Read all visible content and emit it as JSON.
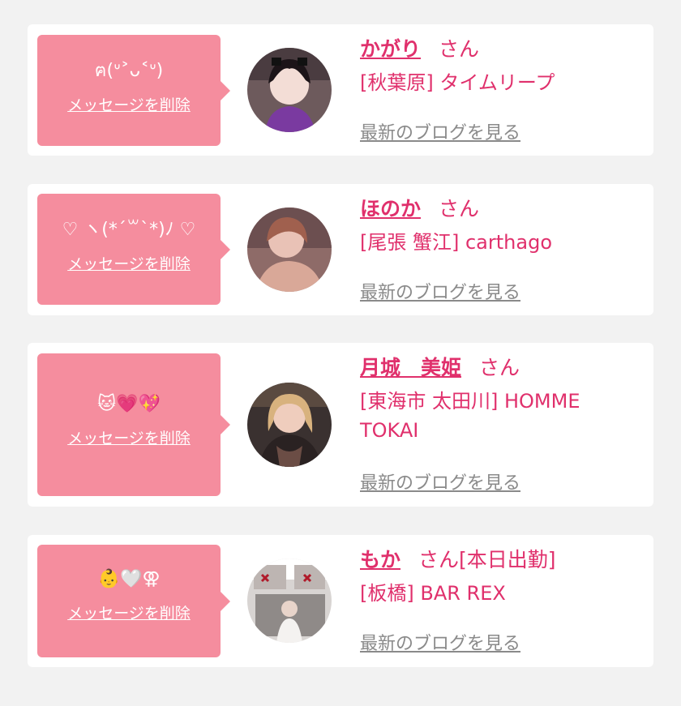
{
  "common": {
    "delete_label": "メッセージを削除",
    "san_label": "さん",
    "blog_label": "最新のブログを見る"
  },
  "colors": {
    "accent": "#e0306c",
    "bubble": "#f58d9e",
    "link_gray": "#8a8a8a",
    "background": "#f2f2f2"
  },
  "items": [
    {
      "message": "ฅ(ᐡ˃ᴗ˂ᐡ)",
      "name": "かがり",
      "shop": "[秋葉原] タイムリープ",
      "status": ""
    },
    {
      "message": "♡ ヽ(*´꒳`*)ﾉ ♡",
      "name": "ほのか",
      "shop": "[尾張 蟹江] carthago",
      "status": ""
    },
    {
      "message": "🐱💗💖",
      "name": "月城　美姫",
      "shop": "[東海市 太田川] HOMME TOKAI",
      "status": ""
    },
    {
      "message": "👶🤍⚢",
      "name": "もか",
      "shop": "[板橋] BAR REX",
      "status": "[本日出勤]"
    }
  ]
}
